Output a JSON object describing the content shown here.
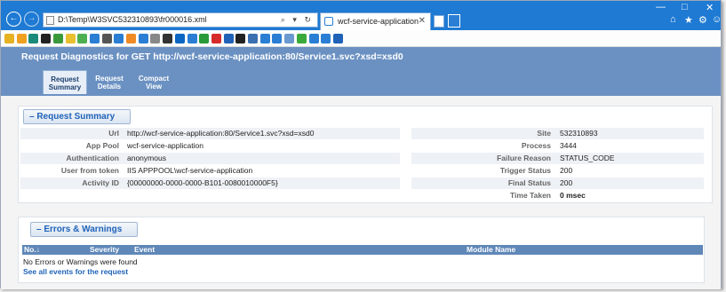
{
  "browser": {
    "address": "D:\\Temp\\W3SVC532310893\\fr000016.xml",
    "address_tools": "⌕ ▾ ↻",
    "tab_title": "wcf-service-application",
    "tab_close": "✕",
    "back": "←",
    "forward": "→",
    "min": "—",
    "max": "□",
    "close": "✕",
    "home": "⌂",
    "star": "★",
    "settings": "⚙",
    "smiley": "☺"
  },
  "favorites": [
    {
      "icon": "star-add-icon",
      "color": "#e6b122"
    },
    {
      "icon": "star-feed-icon",
      "color": "#f0a020"
    },
    {
      "icon": "bing-icon",
      "color": "#1a8a7a"
    },
    {
      "icon": "m-icon",
      "color": "#222222"
    },
    {
      "icon": "tree-icon",
      "color": "#3a9a3a"
    },
    {
      "icon": "bulb-icon",
      "color": "#e8c030"
    },
    {
      "icon": "leaf-icon",
      "color": "#4caf50"
    },
    {
      "icon": "shared-icon",
      "color": "#2a7fd4"
    },
    {
      "icon": "chart-icon",
      "color": "#555555"
    },
    {
      "icon": "link-icon",
      "color": "#2a7fd4"
    },
    {
      "icon": "sun-icon",
      "color": "#f08a24"
    },
    {
      "icon": "d-icon",
      "color": "#2a7fd4"
    },
    {
      "icon": "stamp-icon",
      "color": "#888888"
    },
    {
      "icon": "telescope-icon",
      "color": "#333333"
    },
    {
      "icon": "linkedin-icon",
      "color": "#0a66c2"
    },
    {
      "icon": "doc-icon",
      "color": "#2a7fd4"
    },
    {
      "icon": "grid-icon",
      "color": "#2a9a3a"
    },
    {
      "icon": "youtube-icon",
      "color": "#d62b2b"
    },
    {
      "icon": "dw-icon",
      "color": "#1f62b8"
    },
    {
      "icon": "github-icon",
      "color": "#222222"
    },
    {
      "icon": "page-icon",
      "color": "#3a6fb0"
    },
    {
      "icon": "vs-icon",
      "color": "#2a7fd4"
    },
    {
      "icon": "w-icon",
      "color": "#2a7fd4"
    },
    {
      "icon": "page2-icon",
      "color": "#6a9ad0"
    },
    {
      "icon": "green-icon",
      "color": "#3aaa3a"
    },
    {
      "icon": "page3-icon",
      "color": "#2a7fd4"
    },
    {
      "icon": "windows-icon",
      "color": "#2a7fd4"
    },
    {
      "icon": "ms-icon",
      "color": "#1f62b8"
    }
  ],
  "page": {
    "title": "Request Diagnostics for GET http://wcf-service-application:80/Service1.svc?xsd=xsd0",
    "tabs": [
      {
        "label": "Request Summary"
      },
      {
        "label": "Request Details"
      },
      {
        "label": "Compact View"
      }
    ]
  },
  "summary": {
    "header": "– Request Summary",
    "left": [
      {
        "key": "Url",
        "value": "http://wcf-service-application:80/Service1.svc?xsd=xsd0"
      },
      {
        "key": "App Pool",
        "value": "wcf-service-application"
      },
      {
        "key": "Authentication",
        "value": "anonymous"
      },
      {
        "key": "User from token",
        "value": "IIS APPPOOL\\wcf-service-application"
      },
      {
        "key": "Activity ID",
        "value": "{00000000-0000-0000-B101-0080010000F5}"
      }
    ],
    "right": [
      {
        "key": "Site",
        "value": "532310893"
      },
      {
        "key": "Process",
        "value": "3444"
      },
      {
        "key": "Failure Reason",
        "value": "STATUS_CODE"
      },
      {
        "key": "Trigger Status",
        "value": "200"
      },
      {
        "key": "Final Status",
        "value": "200"
      },
      {
        "key": "Time Taken",
        "value": "0 msec"
      }
    ]
  },
  "errors": {
    "header": "– Errors & Warnings",
    "columns": [
      "No.↓",
      "Severity",
      "Event",
      "Module Name"
    ],
    "empty_message": "No Errors or Warnings were found",
    "see_all": "See all events for the request"
  }
}
